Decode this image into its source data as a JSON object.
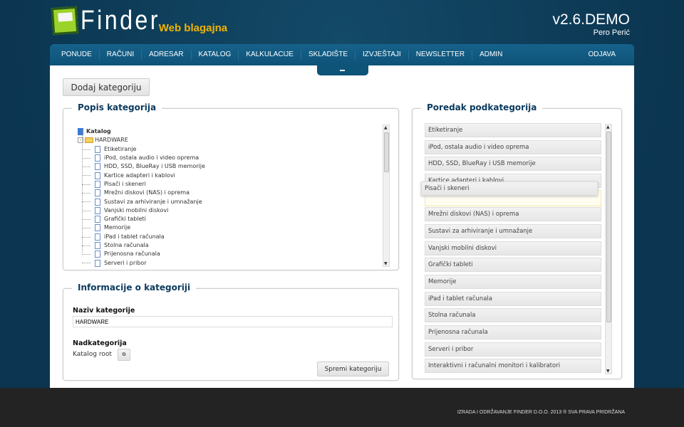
{
  "header": {
    "logo_name": "Finder",
    "logo_sub": "Web blagajna",
    "version": "v2.6.DEMO",
    "user": "Pero Perić"
  },
  "nav": {
    "items": [
      "PONUDE",
      "RAČUNI",
      "ADRESAR",
      "KATALOG",
      "KALKULACIJE",
      "SKLADIŠTE",
      "IZVJEŠTAJI",
      "NEWSLETTER",
      "ADMIN"
    ],
    "logout": "ODJAVA"
  },
  "add_button": "Dodaj kategoriju",
  "tree": {
    "title": "Popis kategorija",
    "root": "Katalog",
    "folder": "HARDWARE",
    "items": [
      "Etiketiranje",
      "iPod, ostala audio i video oprema",
      "HDD, SSD, BlueRay i USB memorije",
      "Kartice adapteri i kablovi",
      "Pisači i skeneri",
      "Mrežni diskovi (NAS) i oprema",
      "Sustavi za arhiviranje i umnažanje",
      "Vanjski mobilni diskovi",
      "Grafički tableti",
      "Memorije",
      "iPad i tablet računala",
      "Stolna računala",
      "Prijenosna računala",
      "Serveri i pribor"
    ]
  },
  "info": {
    "title": "Informacije o kategoriji",
    "name_label": "Naziv kategorije",
    "name_value": "HARDWARE",
    "parent_label": "Nadkategorija",
    "parent_value": "Katalog root",
    "save": "Spremi kategoriju"
  },
  "order": {
    "title": "Poredak podkategorija",
    "items": [
      "Etiketiranje",
      "iPod, ostala audio i video oprema",
      "HDD, SSD, BlueRay i USB memorije",
      "Kartice adapteri i kablovi",
      "Mrežni diskovi (NAS) i oprema",
      "Sustavi za arhiviranje i umnažanje",
      "Vanjski mobilni diskovi",
      "Grafički tableti",
      "Memorije",
      "iPad i tablet računala",
      "Stolna računala",
      "Prijenosna računala",
      "Serveri i pribor",
      "Interaktivni i računalni monitori i kalibratori"
    ],
    "dragging": "Pisači i skeneri"
  },
  "footer": "IZRADA I ODRŽAVANJE FINDER D.O.O. 2013 ® SVA PRAVA PRIDRŽANA"
}
